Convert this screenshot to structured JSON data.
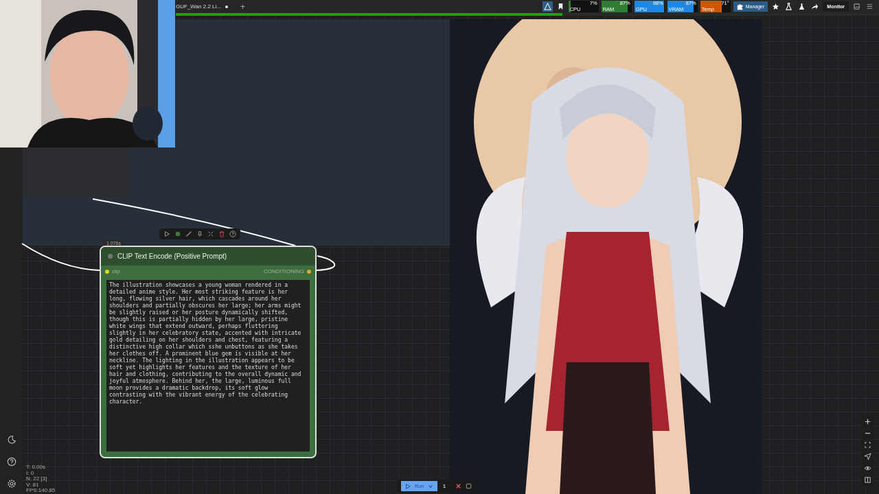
{
  "tab": {
    "title": "GUF_Wan 2.2 Li...",
    "modified": true
  },
  "new_tab": "+",
  "queue_progress": {
    "level": 0.55
  },
  "monitors": [
    {
      "label": "CPU",
      "reading": "7%",
      "level": 0.07,
      "color": "#2e7d32"
    },
    {
      "label": "RAM",
      "reading": "87%",
      "level": 0.87,
      "color": "#2e7d32"
    },
    {
      "label": "GPU",
      "reading": "98%",
      "level": 0.98,
      "color": "#1e88e5"
    },
    {
      "label": "VRAM",
      "reading": "87%",
      "level": 0.87,
      "color": "#1e88e5"
    },
    {
      "label": "Temp",
      "reading": "71°",
      "level": 0.71,
      "color": "#d35400"
    }
  ],
  "manager_button": "Manager",
  "monitor_button": "Monitor",
  "node": {
    "time": "1.076s",
    "title": "CLIP Text Encode (Positive Prompt)",
    "input": "clip",
    "output": "CONDITIONING",
    "prompt": "The illustration showcases a young woman rendered in a detailed anime style. Her most striking feature is her long, flowing silver hair, which cascades around her shoulders and partially obscures her large; her arms might be slightly raised or her posture dynamically shifted, though this is partially hidden by her large, pristine white wings that extend outward, perhaps fluttering slightly in her celebratory state, accented with intricate gold detailing on her shoulders and chest, featuring a distinctive high collar which sshe unbuttons as she takes her clothes off. A prominent blue gem is visible at her neckline. The lighting in the illustration appears to be soft yet highlights her features and the texture of her hair and clothing, contributing to the overall dynamic and joyful atmosphere. Behind her, the large, luminous full moon provides a dramatic backdrop, its soft glow contrasting with the vibrant energy of the celebrating character."
  },
  "stats": [
    "T: 0.00s",
    "I: 0",
    "N: 22 [3]",
    "V: 81",
    "FPS:140.85"
  ],
  "run_bar": {
    "run": "Run",
    "count": "1"
  }
}
